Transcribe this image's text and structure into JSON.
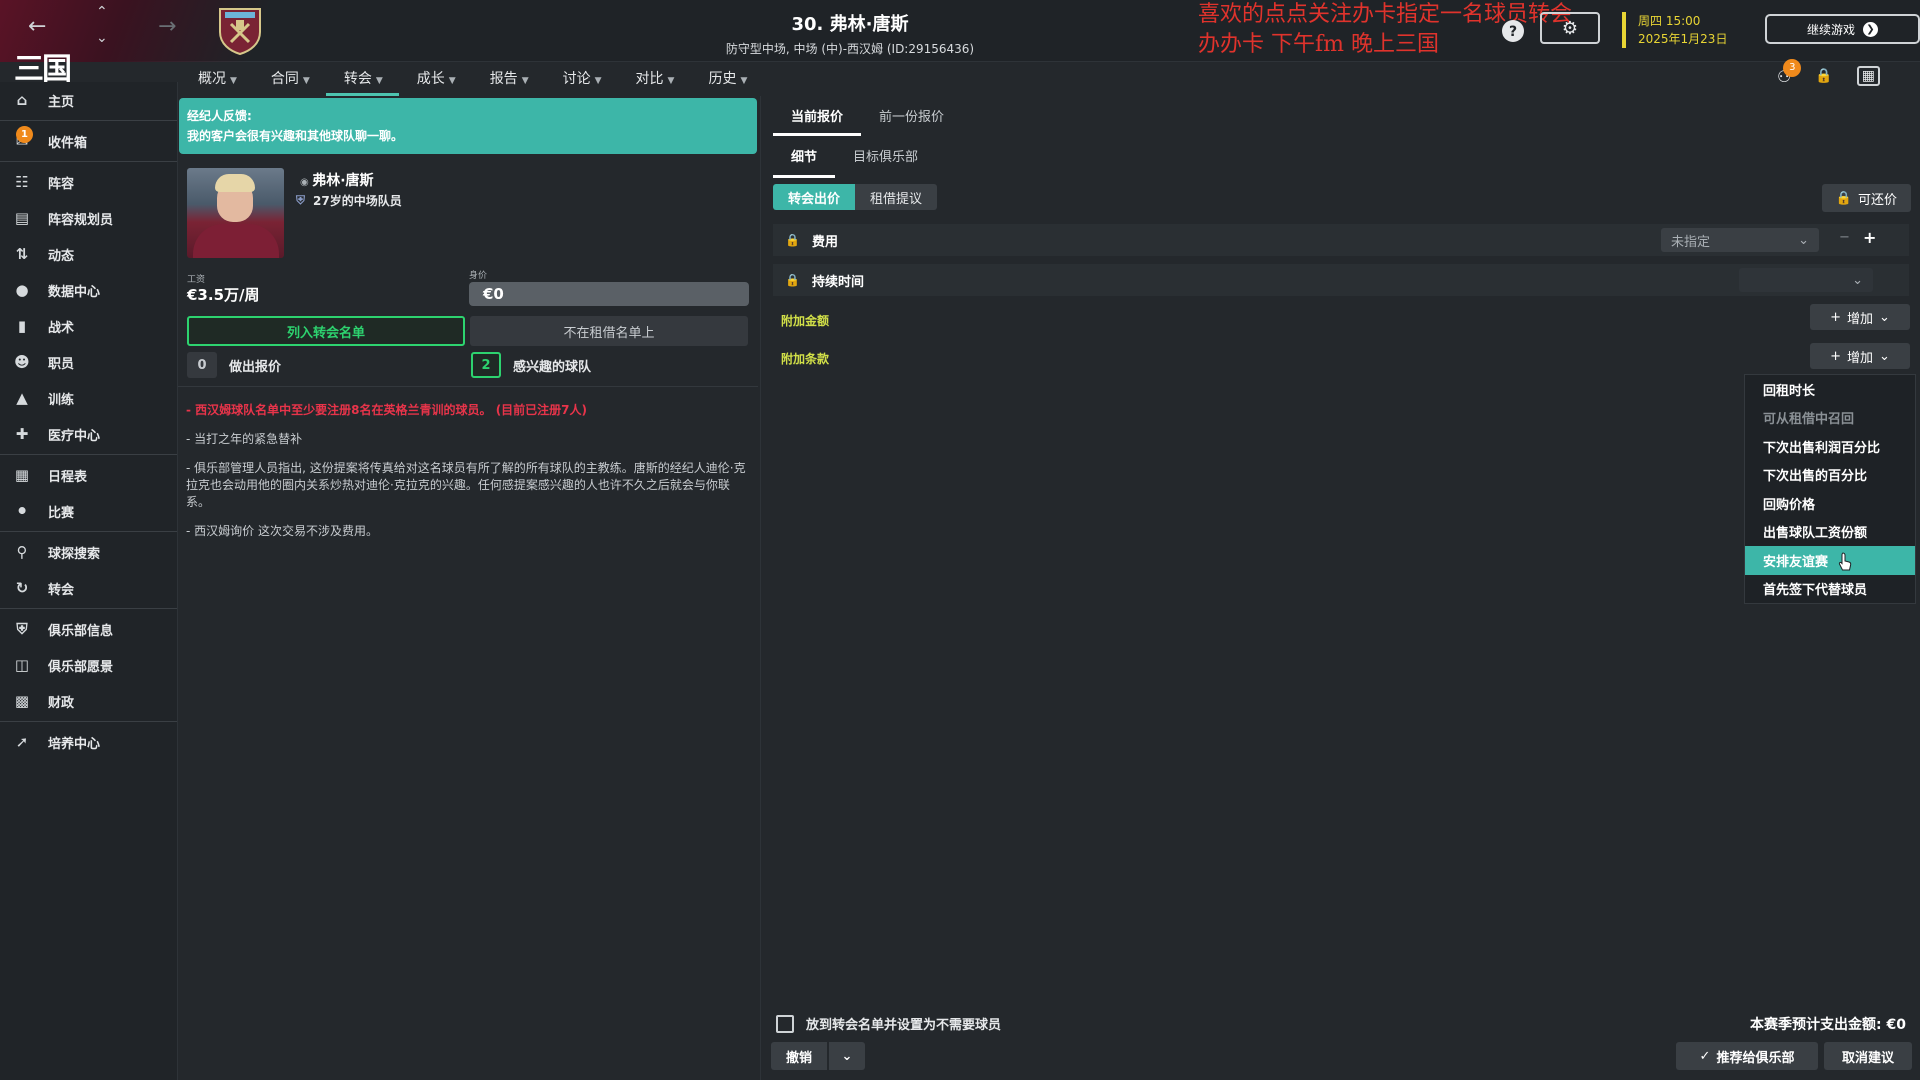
{
  "topbar": {
    "logo": "三国",
    "title": "30. 弗林·唐斯",
    "subtitle": "防守型中场, 中场 (中)-西汉姆 (ID:29156436)",
    "overlay_line1": "喜欢的点点关注办卡指定一名球员转会",
    "overlay_line2": "办办卡  下午fm  晚上三国",
    "date_line1": "周四 15:00",
    "date_line2": "2025年1月23日",
    "continue_label": "继续游戏",
    "notification_count": "3",
    "accent_color": "#e8d534"
  },
  "tabs": [
    {
      "label": "概况"
    },
    {
      "label": "合同"
    },
    {
      "label": "转会"
    },
    {
      "label": "成长"
    },
    {
      "label": "报告"
    },
    {
      "label": "讨论"
    },
    {
      "label": "对比"
    },
    {
      "label": "历史"
    }
  ],
  "sidebar": {
    "inbox_badge": "1",
    "items": [
      {
        "label": "主页",
        "icon": "home-icon"
      },
      {
        "label": "收件箱",
        "icon": "inbox-icon"
      },
      {
        "label": "阵容",
        "icon": "shirt-icon"
      },
      {
        "label": "阵容规划员",
        "icon": "clipboard-icon"
      },
      {
        "label": "动态",
        "icon": "dynamics-icon"
      },
      {
        "label": "数据中心",
        "icon": "data-icon"
      },
      {
        "label": "战术",
        "icon": "tactics-icon"
      },
      {
        "label": "职员",
        "icon": "staff-icon"
      },
      {
        "label": "训练",
        "icon": "training-icon"
      },
      {
        "label": "医疗中心",
        "icon": "medical-icon"
      },
      {
        "label": "日程表",
        "icon": "calendar-icon"
      },
      {
        "label": "比赛",
        "icon": "trophy-icon"
      },
      {
        "label": "球探搜索",
        "icon": "search-icon"
      },
      {
        "label": "转会",
        "icon": "transfer-icon"
      },
      {
        "label": "俱乐部信息",
        "icon": "shield-icon"
      },
      {
        "label": "俱乐部愿景",
        "icon": "vision-icon"
      },
      {
        "label": "财政",
        "icon": "finance-icon"
      },
      {
        "label": "培养中心",
        "icon": "development-icon"
      }
    ]
  },
  "agent": {
    "title": "经纪人反馈:",
    "text": "我的客户会很有兴趣和其他球队聊一聊。"
  },
  "player": {
    "name": "弗林·唐斯",
    "desc": "27岁的中场队员",
    "wage_label": "工资",
    "wage": "€3.5万/周",
    "value_label": "身价",
    "value": "€0",
    "list_button": "列入转会名单",
    "loan_button": "不在租借名单上",
    "offers_count": "0",
    "offers_label": "做出报价",
    "interested_count": "2",
    "interested_label": "感兴趣的球队"
  },
  "notes": [
    "- 西汉姆球队名单中至少要注册8名在英格兰青训的球员。 (目前已注册7人)",
    "- 当打之年的紧急替补",
    "- 俱乐部管理人员指出, 这份提案将传真给对这名球员有所了解的所有球队的主教练。唐斯的经纪人迪伦·克拉克也会动用他的圈内关系炒热对迪伦·克拉克的兴趣。任何感提案感兴趣的人也许不久之后就会与你联系。",
    "- 西汉姆询价 这次交易不涉及费用。"
  ],
  "offer": {
    "tab_current": "当前报价",
    "tab_previous": "前一份报价",
    "subtab_details": "细节",
    "subtab_target": "目标俱乐部",
    "seg_transfer": "转会出价",
    "seg_loan": "租借提议",
    "negotiable": "可还价",
    "fee_label": "费用",
    "fee_value": "未指定",
    "duration_label": "持续时间",
    "add_amount_label": "附加金额",
    "add_clause_label": "附加条款",
    "add_button": "增加"
  },
  "clause_menu": [
    {
      "label": "回租时长",
      "state": "normal"
    },
    {
      "label": "可从租借中召回",
      "state": "disabled"
    },
    {
      "label": "下次出售利润百分比",
      "state": "normal"
    },
    {
      "label": "下次出售的百分比",
      "state": "normal"
    },
    {
      "label": "回购价格",
      "state": "normal"
    },
    {
      "label": "出售球队工资份额",
      "state": "normal"
    },
    {
      "label": "安排友谊赛",
      "state": "hover"
    },
    {
      "label": "首先签下代替球员",
      "state": "normal"
    }
  ],
  "footer": {
    "checkbox_label": "放到转会名单并设置为不需要球员",
    "budget": "本赛季预计支出金额: €0",
    "cancel": "撤销",
    "recommend": "推荐给俱乐部",
    "withdraw": "取消建议"
  }
}
